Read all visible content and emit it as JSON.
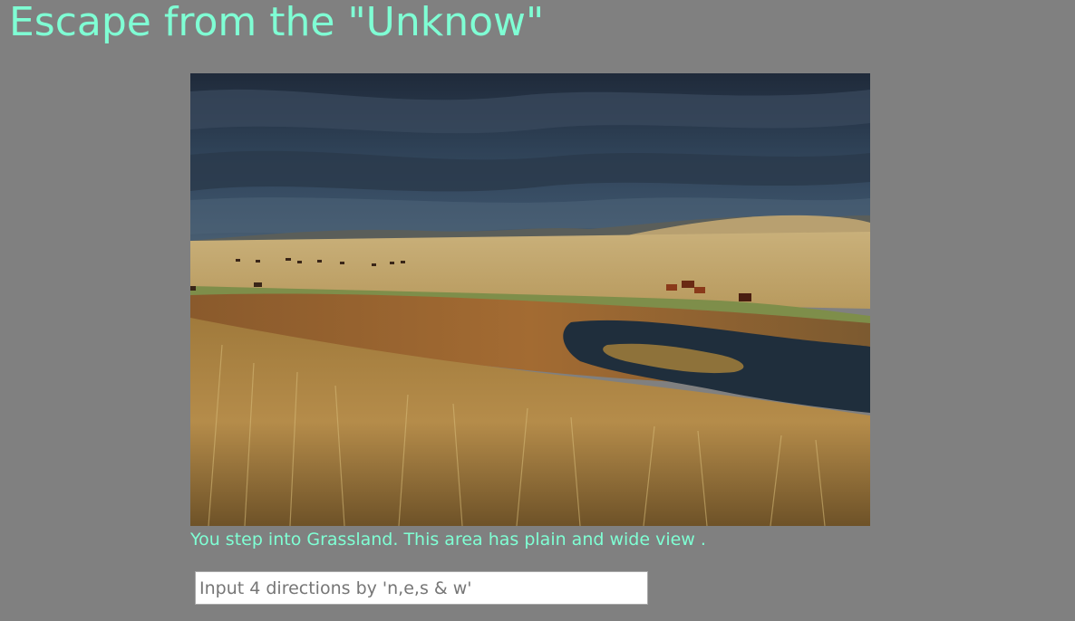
{
  "page": {
    "title": "Escape from the \"Unknow\"",
    "description": "You step into Grassland. This area has plain and wide view .",
    "image_subject": "grassland-landscape"
  },
  "command": {
    "placeholder": "Input 4 directions by 'n,e,s & w'",
    "value": ""
  },
  "colors": {
    "background": "#808080",
    "accent_text": "#7fffd4"
  }
}
